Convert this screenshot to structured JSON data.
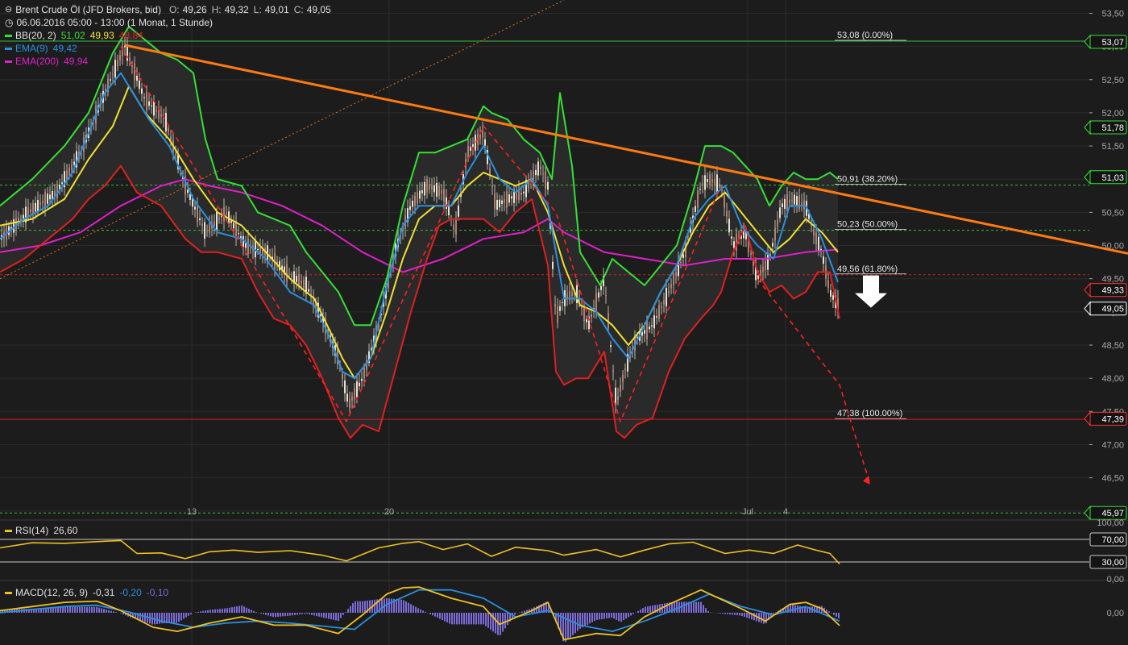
{
  "header": {
    "instrument": "Brent Crude Öl (JFD Brokers, bid)",
    "ohlc": {
      "o_label": "O:",
      "o": "49,26",
      "h_label": "H:",
      "h": "49,32",
      "l_label": "L:",
      "l": "49,01",
      "c_label": "C:",
      "c": "49,05"
    },
    "period": "06.06.2016 05:00 - 13:00 (1 Monat, 1 Stunde)",
    "indicators": [
      {
        "name": "BB(20, 2)",
        "values": [
          "51,02",
          "49,93",
          "48,84"
        ],
        "colors": [
          "#35e035",
          "#f0e030",
          "#e02020"
        ]
      },
      {
        "name": "EMA(9)",
        "values": [
          "49,42"
        ],
        "colors": [
          "#2a8fe0"
        ]
      },
      {
        "name": "EMA(200)",
        "values": [
          "49,94"
        ],
        "colors": [
          "#e020c8"
        ]
      }
    ]
  },
  "colors": {
    "background": "#1c1c1c",
    "grid": "#2b2b2b",
    "axis_text": "#a8a8a8",
    "bb_upper": "#35e035",
    "bb_mid": "#f0e030",
    "bb_lower": "#e02020",
    "ema9": "#2a8fe0",
    "ema200": "#e020c8",
    "trendline": "#ff7a10",
    "projection": "#ff2020",
    "fib_line": "#e8e8e8",
    "rsi": "#f0c020",
    "macd": "#f0c020",
    "signal": "#2a8fe0",
    "histogram": "#7b6bd6"
  },
  "chart_data": [
    {
      "type": "line",
      "title": "Brent Crude Öl (JFD Brokers, bid)",
      "y_axis_ticks": [
        "53,50",
        "53,00",
        "52,50",
        "52,00",
        "51,50",
        "51,00",
        "50,50",
        "50,00",
        "49,50",
        "49,00",
        "48,50",
        "48,00",
        "47,50",
        "47,00",
        "46,50",
        "46,00"
      ],
      "ylim": [
        45.9,
        53.7
      ],
      "x_axis_ticks": [
        "13",
        "20",
        "Jul",
        "4"
      ],
      "grid": true,
      "price_labels": [
        {
          "label": "53,07",
          "value": 53.07,
          "color": "#35e035"
        },
        {
          "label": "51,78",
          "value": 51.78,
          "color": "#35e035"
        },
        {
          "label": "51,03",
          "value": 51.03,
          "color": "#35e035"
        },
        {
          "label": "49,33",
          "value": 49.33,
          "color": "#ff3030"
        },
        {
          "label": "49,05",
          "value": 49.05,
          "color": "#ffffff"
        },
        {
          "label": "47,39",
          "value": 47.39,
          "color": "#ff3030"
        },
        {
          "label": "45,97",
          "value": 45.97,
          "color": "#35e035"
        }
      ],
      "fibonacci": [
        {
          "label": "53,08 (0.00%)",
          "value": 53.08
        },
        {
          "label": "50,91 (38.20%)",
          "value": 50.91
        },
        {
          "label": "50,23 (50.00%)",
          "value": 50.23
        },
        {
          "label": "49,56 (61.80%)",
          "value": 49.56
        },
        {
          "label": "47,38 (100.00%)",
          "value": 47.38
        }
      ],
      "series": [
        {
          "name": "Brent Crude Öl",
          "key": "close",
          "x": [
            0,
            35,
            70,
            100,
            130,
            155,
            180,
            205,
            230,
            255,
            280,
            305,
            330,
            355,
            380,
            400,
            420,
            433,
            450,
            470,
            490,
            510,
            530,
            550,
            565,
            580,
            600,
            615,
            630,
            650,
            670,
            680,
            690,
            700,
            715,
            730,
            750,
            765,
            775,
            790,
            810,
            830,
            850,
            870,
            880,
            895,
            910,
            925,
            940,
            955,
            970,
            985,
            1000,
            1010,
            1020,
            1030,
            1042
          ],
          "y": [
            50.1,
            50.5,
            50.8,
            51.4,
            52.3,
            53.0,
            52.2,
            51.9,
            50.9,
            50.2,
            50.5,
            50.0,
            49.9,
            49.6,
            49.4,
            48.9,
            48.3,
            47.6,
            48.0,
            48.8,
            49.9,
            50.6,
            50.9,
            50.8,
            50.2,
            51.4,
            51.7,
            50.6,
            50.7,
            50.8,
            51.2,
            50.9,
            48.9,
            49.2,
            49.3,
            48.8,
            49.5,
            47.6,
            48.1,
            48.6,
            48.8,
            49.3,
            49.9,
            50.9,
            51.0,
            50.9,
            50.0,
            50.2,
            49.5,
            49.8,
            50.6,
            50.7,
            50.6,
            50.2,
            49.9,
            49.3,
            49.05
          ]
        },
        {
          "name": "BB(20, 2)",
          "key": "bb_upper",
          "x": [
            0,
            40,
            80,
            110,
            140,
            160,
            180,
            200,
            220,
            240,
            255,
            270,
            300,
            320,
            340,
            360,
            380,
            400,
            420,
            440,
            460,
            480,
            500,
            520,
            540,
            560,
            580,
            600,
            610,
            630,
            650,
            670,
            685,
            695,
            710,
            720,
            730,
            745,
            760,
            780,
            800,
            820,
            840,
            860,
            875,
            895,
            910,
            925,
            940,
            955,
            970,
            985,
            1000,
            1015,
            1030,
            1040
          ],
          "y": [
            50.6,
            51.0,
            51.5,
            52.0,
            52.9,
            53.3,
            53.1,
            52.9,
            52.8,
            52.6,
            51.6,
            51.0,
            50.9,
            50.5,
            50.4,
            50.3,
            49.9,
            49.6,
            49.3,
            48.8,
            48.8,
            49.5,
            50.6,
            51.4,
            51.4,
            51.5,
            51.6,
            52.1,
            52.0,
            51.9,
            51.6,
            51.4,
            51.0,
            52.3,
            51.2,
            49.9,
            49.7,
            49.4,
            49.8,
            49.6,
            49.4,
            49.7,
            50.0,
            50.8,
            51.5,
            51.5,
            51.4,
            51.2,
            51.0,
            50.6,
            50.9,
            51.1,
            51.0,
            51.0,
            51.1,
            51.0
          ]
        },
        {
          "name": "BB(20, 2)",
          "key": "bb_middle",
          "x": [
            0,
            40,
            80,
            110,
            140,
            160,
            180,
            210,
            240,
            270,
            300,
            330,
            360,
            390,
            410,
            425,
            440,
            460,
            480,
            500,
            520,
            540,
            560,
            580,
            600,
            620,
            640,
            660,
            680,
            700,
            720,
            740,
            760,
            780,
            800,
            820,
            840,
            860,
            880,
            900,
            920,
            940,
            960,
            980,
            1000,
            1020,
            1040
          ],
          "y": [
            50.3,
            50.4,
            50.7,
            51.3,
            51.8,
            52.4,
            52.0,
            51.6,
            51.0,
            50.5,
            50.3,
            49.9,
            49.5,
            49.2,
            48.7,
            48.3,
            48.0,
            48.3,
            49.0,
            49.8,
            50.4,
            50.6,
            50.6,
            50.9,
            51.1,
            51.0,
            50.9,
            51.0,
            50.5,
            49.7,
            49.1,
            49.0,
            48.8,
            48.5,
            48.8,
            49.3,
            49.7,
            50.2,
            50.6,
            50.8,
            50.5,
            50.2,
            49.9,
            50.1,
            50.4,
            50.2,
            49.9
          ]
        },
        {
          "name": "BB(20, 2)",
          "key": "bb_lower",
          "x": [
            0,
            30,
            60,
            90,
            110,
            130,
            150,
            170,
            200,
            230,
            250,
            270,
            300,
            320,
            340,
            360,
            380,
            400,
            420,
            435,
            450,
            470,
            490,
            510,
            530,
            545,
            560,
            580,
            600,
            620,
            640,
            660,
            680,
            690,
            700,
            715,
            730,
            750,
            765,
            775,
            790,
            810,
            830,
            850,
            870,
            885,
            895,
            910,
            925,
            940,
            955,
            970,
            985,
            1000,
            1015,
            1030,
            1042
          ],
          "y": [
            49.6,
            49.8,
            50.1,
            50.4,
            50.7,
            50.9,
            51.2,
            50.8,
            50.6,
            50.1,
            49.9,
            49.9,
            49.8,
            49.3,
            48.9,
            48.8,
            48.5,
            48.0,
            47.4,
            47.1,
            47.3,
            47.2,
            48.1,
            49.0,
            49.8,
            50.3,
            50.4,
            50.4,
            50.4,
            50.2,
            50.5,
            50.7,
            49.7,
            48.1,
            47.9,
            48.0,
            48.0,
            48.4,
            47.2,
            47.1,
            47.3,
            47.4,
            48.1,
            48.6,
            48.9,
            49.1,
            49.3,
            49.9,
            50.3,
            49.6,
            49.3,
            49.4,
            49.2,
            49.3,
            49.6,
            49.6,
            48.9
          ]
        },
        {
          "name": "EMA(9)",
          "key": "ema9",
          "x": [
            0,
            30,
            60,
            90,
            110,
            130,
            150,
            165,
            185,
            210,
            240,
            270,
            300,
            330,
            360,
            390,
            410,
            425,
            440,
            460,
            480,
            500,
            520,
            540,
            560,
            580,
            600,
            620,
            640,
            660,
            680,
            700,
            720,
            740,
            760,
            780,
            800,
            820,
            840,
            860,
            880,
            900,
            920,
            940,
            960,
            980,
            1000,
            1020,
            1040
          ],
          "y": [
            50.1,
            50.4,
            50.6,
            51.1,
            51.7,
            52.3,
            52.6,
            52.3,
            51.9,
            51.5,
            50.7,
            50.2,
            50.1,
            49.8,
            49.3,
            49.1,
            48.6,
            48.1,
            48.0,
            48.3,
            49.4,
            50.3,
            50.6,
            50.6,
            50.6,
            51.1,
            51.5,
            51.0,
            50.8,
            51.0,
            50.6,
            49.2,
            49.2,
            49.0,
            48.6,
            48.3,
            48.8,
            49.3,
            49.7,
            50.4,
            50.7,
            50.9,
            50.3,
            50.0,
            49.8,
            50.6,
            50.6,
            50.1,
            49.45
          ]
        },
        {
          "name": "EMA(200)",
          "key": "ema200",
          "x": [
            0,
            50,
            100,
            150,
            200,
            230,
            260,
            300,
            350,
            400,
            450,
            500,
            550,
            600,
            650,
            680,
            700,
            750,
            800,
            850,
            900,
            950,
            1000,
            1040
          ],
          "y": [
            49.9,
            50.0,
            50.2,
            50.6,
            50.9,
            51.0,
            50.9,
            50.8,
            50.6,
            50.3,
            49.9,
            49.6,
            49.8,
            50.1,
            50.2,
            50.4,
            50.2,
            49.9,
            49.8,
            49.7,
            49.8,
            49.8,
            49.9,
            49.94
          ]
        }
      ],
      "trendline": {
        "x": [
          155,
          1400
        ],
        "y": [
          53.02,
          49.88
        ]
      },
      "projections": [
        {
          "x": [
            150,
            300,
            430,
            600,
            690,
            770,
            895
          ],
          "y": [
            53.0,
            50.0,
            47.35,
            51.8,
            50.5,
            47.35,
            50.9
          ]
        },
        {
          "x": [
            940,
            1042,
            1080
          ],
          "y": [
            49.5,
            47.9,
            46.4
          ]
        }
      ]
    },
    {
      "type": "line",
      "title": "RSI(14)",
      "series": [
        {
          "name": "RSI(14)",
          "value_label": "26,60",
          "x": [
            0,
            40,
            80,
            120,
            150,
            170,
            200,
            230,
            260,
            290,
            320,
            360,
            400,
            430,
            470,
            500,
            520,
            550,
            580,
            610,
            640,
            680,
            700,
            740,
            770,
            800,
            830,
            860,
            900,
            930,
            960,
            990,
            1010,
            1030,
            1042
          ],
          "y": [
            55,
            64,
            63,
            66,
            68,
            45,
            46,
            36,
            48,
            51,
            47,
            50,
            42,
            32,
            55,
            63,
            66,
            52,
            62,
            40,
            56,
            50,
            42,
            52,
            39,
            51,
            62,
            65,
            45,
            51,
            45,
            60,
            52,
            45,
            26.6
          ]
        }
      ],
      "y_axis_ticks": [
        "100,00",
        "70,00",
        "30,00",
        "0,00"
      ],
      "ylim": [
        0,
        100
      ]
    },
    {
      "type": "line",
      "title": "MACD(12, 26, 9)",
      "series": [
        {
          "name": "MACD",
          "value_label": "-0,31",
          "x": [
            0,
            40,
            80,
            120,
            150,
            190,
            220,
            260,
            300,
            340,
            380,
            420,
            450,
            480,
            500,
            520,
            560,
            600,
            620,
            660,
            680,
            700,
            740,
            770,
            800,
            830,
            870,
            920,
            950,
            980,
            1000,
            1020,
            1042
          ],
          "y": [
            0.05,
            0.15,
            0.25,
            0.28,
            0.05,
            -0.35,
            -0.45,
            -0.25,
            -0.1,
            -0.3,
            -0.3,
            -0.5,
            -0.05,
            0.45,
            0.6,
            0.62,
            0.35,
            0.15,
            -0.28,
            0.05,
            0.25,
            -0.65,
            -0.5,
            -0.55,
            -0.1,
            0.2,
            0.55,
            0.1,
            -0.2,
            0.2,
            0.25,
            0.1,
            -0.31
          ]
        },
        {
          "name": "Signal",
          "value_label": "-0,20",
          "x": [
            0,
            40,
            80,
            120,
            160,
            200,
            240,
            280,
            320,
            360,
            400,
            440,
            480,
            520,
            560,
            600,
            640,
            680,
            720,
            760,
            800,
            840,
            880,
            920,
            960,
            1000,
            1042
          ],
          "y": [
            0.0,
            0.08,
            0.15,
            0.18,
            0.02,
            -0.2,
            -0.35,
            -0.25,
            -0.2,
            -0.25,
            -0.32,
            -0.4,
            0.2,
            0.55,
            0.55,
            0.35,
            -0.1,
            0.05,
            -0.3,
            -0.45,
            -0.2,
            0.1,
            0.45,
            0.15,
            -0.05,
            0.15,
            -0.2
          ]
        },
        {
          "name": "Histogram",
          "value_label": "-0,10"
        }
      ],
      "y_axis_ticks": [
        "0,00"
      ]
    }
  ]
}
